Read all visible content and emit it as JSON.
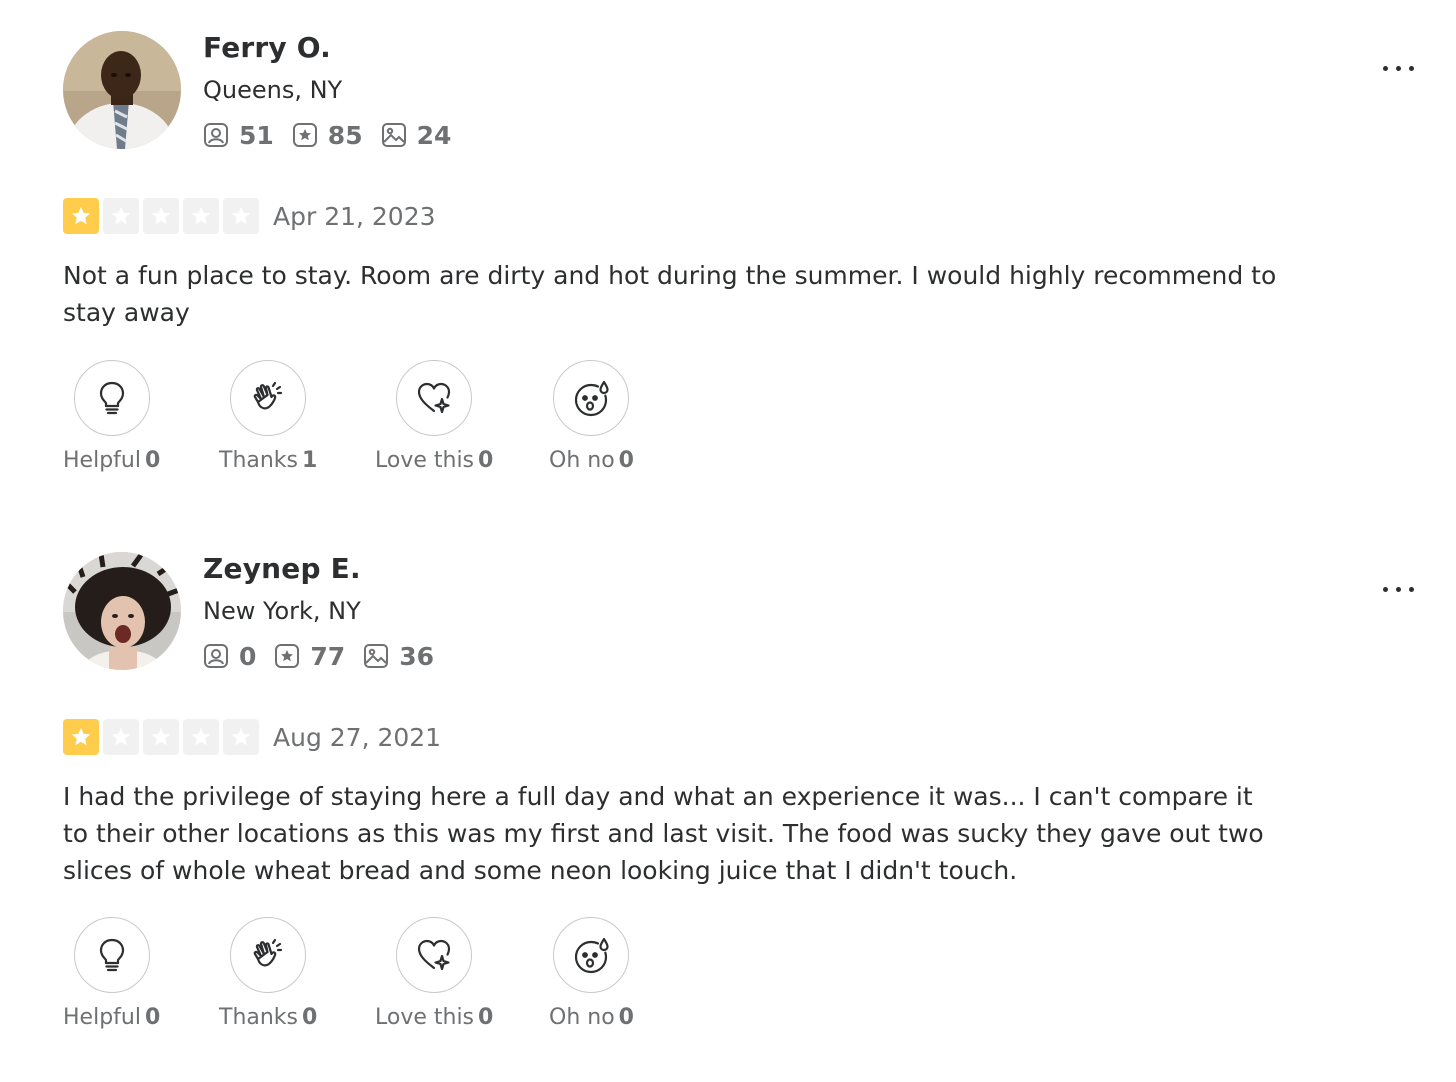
{
  "reviews": [
    {
      "user": {
        "name": "Ferry O.",
        "location": "Queens, NY",
        "friends": "51",
        "reviews": "85",
        "photos": "24"
      },
      "rating": 1,
      "date": "Apr 21, 2023",
      "text": "Not a fun place to stay. Room are dirty and hot during the summer. I would highly recommend to stay away",
      "reactions": {
        "helpful_label": "Helpful",
        "helpful_count": "0",
        "thanks_label": "Thanks",
        "thanks_count": "1",
        "love_label": "Love this",
        "love_count": "0",
        "ohno_label": "Oh no",
        "ohno_count": "0"
      }
    },
    {
      "user": {
        "name": "Zeynep E.",
        "location": "New York, NY",
        "friends": "0",
        "reviews": "77",
        "photos": "36"
      },
      "rating": 1,
      "date": "Aug 27, 2021",
      "text": "I had the privilege of staying here a full day and what an experience it was... I can't compare it to their other locations as this was my first and last visit. The food was sucky they gave out two slices of whole wheat bread and some neon looking juice that I didn't touch.",
      "reactions": {
        "helpful_label": "Helpful",
        "helpful_count": "0",
        "thanks_label": "Thanks",
        "thanks_count": "0",
        "love_label": "Love this",
        "love_count": "0",
        "ohno_label": "Oh no",
        "ohno_count": "0"
      }
    }
  ],
  "colors": {
    "star_filled": "#ffcc4b",
    "star_empty": "#f1f1f1",
    "text_primary": "#2d2e2f",
    "text_secondary": "#6e7072"
  },
  "icons": {
    "friends": "friends-icon",
    "reviews": "star-badge-icon",
    "photos": "photo-icon",
    "helpful": "lightbulb-icon",
    "thanks": "clapping-hands-icon",
    "love": "heart-sparkle-icon",
    "ohno": "surprised-face-icon",
    "more": "more-options-icon"
  }
}
